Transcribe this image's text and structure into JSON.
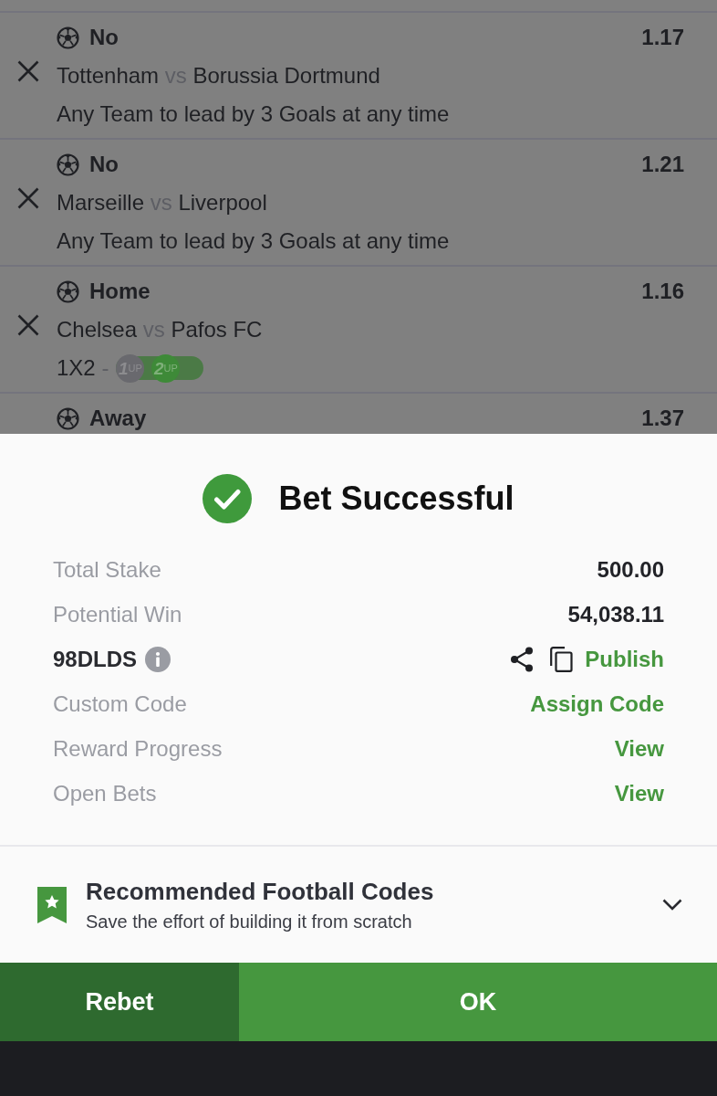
{
  "bets": [
    {
      "pick": "No",
      "odds": "1.17",
      "home": "Tottenham",
      "vs": "vs",
      "away": "Borussia Dortmund",
      "market": "Any Team to lead by 3 Goals at any time"
    },
    {
      "pick": "No",
      "odds": "1.21",
      "home": "Marseille",
      "vs": "vs",
      "away": "Liverpool",
      "market": "Any Team to lead by 3 Goals at any time"
    },
    {
      "pick": "Home",
      "odds": "1.16",
      "home": "Chelsea",
      "vs": "vs",
      "away": "Pafos FC",
      "market": "1X2",
      "separator": "-",
      "boosts": [
        {
          "number": "1",
          "suffix": "UP",
          "selected": false
        },
        {
          "number": "2",
          "suffix": "UP",
          "selected": true
        }
      ]
    },
    {
      "pick": "Away",
      "odds": "1.37"
    }
  ],
  "sheet": {
    "title": "Bet Successful",
    "rows": [
      {
        "kind": "amount",
        "label": "Total Stake",
        "value": "500.00"
      },
      {
        "kind": "amount",
        "label": "Potential Win",
        "value": "54,038.11"
      },
      {
        "kind": "code",
        "label": "98DLDS",
        "value": "Publish"
      },
      {
        "kind": "link",
        "label": "Custom Code",
        "value": "Assign Code"
      },
      {
        "kind": "link",
        "label": "Reward Progress",
        "value": "View"
      },
      {
        "kind": "link",
        "label": "Open Bets",
        "value": "View"
      }
    ]
  },
  "recommended": {
    "title": "Recommended Football Codes",
    "subtitle": "Save the effort of building it from scratch",
    "expanded": false
  },
  "buttons": [
    {
      "kind": "secondary",
      "label": "Rebet"
    },
    {
      "kind": "primary",
      "label": "OK"
    }
  ]
}
